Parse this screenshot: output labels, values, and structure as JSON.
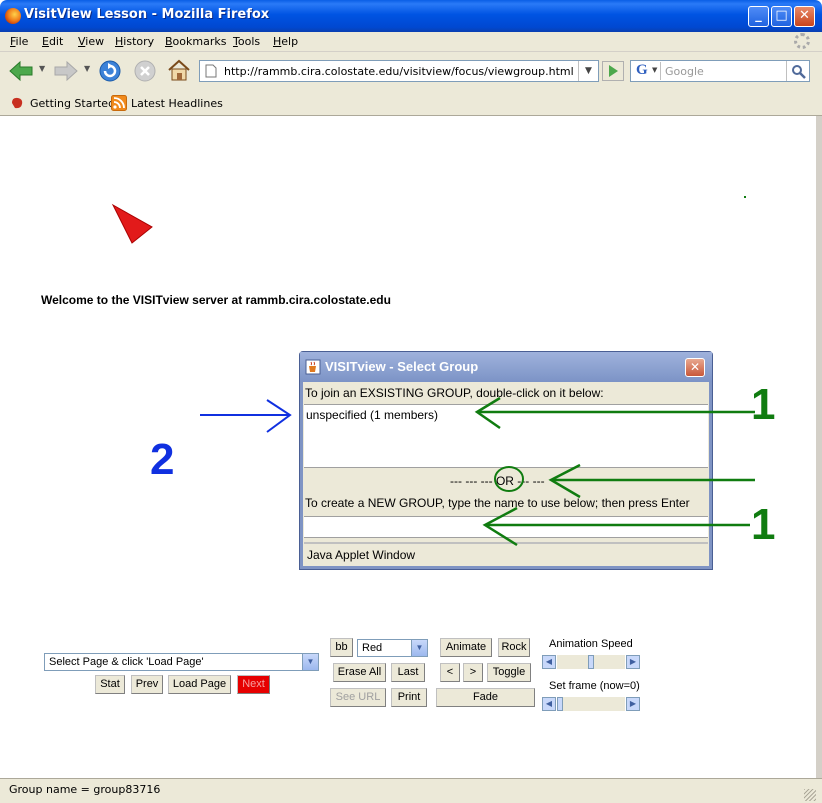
{
  "window": {
    "title": "VisitView Lesson - Mozilla Firefox",
    "minimize": "_",
    "maximize": "□",
    "close": "✕"
  },
  "menu": [
    "File",
    "Edit",
    "View",
    "History",
    "Bookmarks",
    "Tools",
    "Help"
  ],
  "nav": {
    "url": "http://rammb.cira.colostate.edu/visitview/focus/viewgroup.html",
    "search_placeholder": "Google",
    "search_engine_letter": "G"
  },
  "bookmarks": [
    "Getting Started",
    "Latest Headlines"
  ],
  "page": {
    "welcome": "Welcome to the VISITview server at rammb.cira.colostate.edu"
  },
  "dialog": {
    "title": "VISITview - Select Group",
    "close": "✕",
    "join_text": "To join an EXSISTING GROUP, double-click on it below:",
    "groups": [
      "unspecified (1 members)"
    ],
    "or_text": "--- --- --- OR --- ---",
    "create_text": "To create a NEW GROUP, type the name to use below; then press Enter",
    "name_value": "",
    "applet_note": "Java Applet Window"
  },
  "annotations": {
    "label_1": "1",
    "label_2": "2",
    "arrow_green": "#107c10",
    "arrow_blue": "#1030e0"
  },
  "controls": {
    "page_select": "Select Page & click 'Load Page'",
    "stat": "Stat",
    "prev": "Prev",
    "load_page": "Load Page",
    "next": "Next",
    "bb": "bb",
    "color_select": "Red",
    "erase_all": "Erase All",
    "last": "Last",
    "see_url": "See URL",
    "print": "Print",
    "animate": "Animate",
    "rock": "Rock",
    "back": "<",
    "forward": ">",
    "toggle": "Toggle",
    "fade": "Fade",
    "animation_speed_label": "Animation Speed",
    "set_frame_label": "Set frame (now=0)"
  },
  "status": {
    "text": "Group name = group83716"
  }
}
